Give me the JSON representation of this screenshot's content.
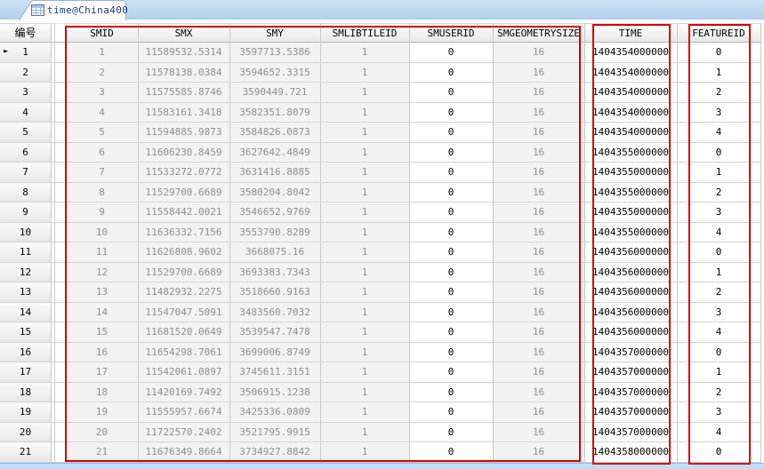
{
  "tab": {
    "label": "time@China400",
    "icon": "table-icon"
  },
  "table": {
    "corner_label": "编号",
    "selected_row": "1",
    "columns": [
      {
        "key": "smid",
        "label": "SMID",
        "readonly": true
      },
      {
        "key": "smx",
        "label": "SMX",
        "readonly": true
      },
      {
        "key": "smy",
        "label": "SMY",
        "readonly": true
      },
      {
        "key": "smlibtileid",
        "label": "SMLIBTILEID",
        "readonly": true
      },
      {
        "key": "smuserid",
        "label": "SMUSERID",
        "readonly": false
      },
      {
        "key": "smgeometrysize",
        "label": "SMGEOMETRYSIZE",
        "readonly": true
      },
      {
        "key": "time",
        "label": "TIME",
        "readonly": false
      },
      {
        "key": "featureid",
        "label": "FEATUREID",
        "readonly": false
      }
    ],
    "rows": [
      {
        "num": "1",
        "smid": "1",
        "smx": "11589532.5314",
        "smy": "3597713.5386",
        "smlibtileid": "1",
        "smuserid": "0",
        "smgeometrysize": "16",
        "time": "1404354000000",
        "featureid": "0"
      },
      {
        "num": "2",
        "smid": "2",
        "smx": "11578138.0384",
        "smy": "3594652.3315",
        "smlibtileid": "1",
        "smuserid": "0",
        "smgeometrysize": "16",
        "time": "1404354000000",
        "featureid": "1"
      },
      {
        "num": "3",
        "smid": "3",
        "smx": "11575585.8746",
        "smy": "3590449.721",
        "smlibtileid": "1",
        "smuserid": "0",
        "smgeometrysize": "16",
        "time": "1404354000000",
        "featureid": "2"
      },
      {
        "num": "4",
        "smid": "4",
        "smx": "11583161.3418",
        "smy": "3582351.8079",
        "smlibtileid": "1",
        "smuserid": "0",
        "smgeometrysize": "16",
        "time": "1404354000000",
        "featureid": "3"
      },
      {
        "num": "5",
        "smid": "5",
        "smx": "11594885.9873",
        "smy": "3584826.0873",
        "smlibtileid": "1",
        "smuserid": "0",
        "smgeometrysize": "16",
        "time": "1404354000000",
        "featureid": "4"
      },
      {
        "num": "6",
        "smid": "6",
        "smx": "11606230.8459",
        "smy": "3627642.4849",
        "smlibtileid": "1",
        "smuserid": "0",
        "smgeometrysize": "16",
        "time": "1404355000000",
        "featureid": "0"
      },
      {
        "num": "7",
        "smid": "7",
        "smx": "11533272.0772",
        "smy": "3631416.8885",
        "smlibtileid": "1",
        "smuserid": "0",
        "smgeometrysize": "16",
        "time": "1404355000000",
        "featureid": "1"
      },
      {
        "num": "8",
        "smid": "8",
        "smx": "11529700.6689",
        "smy": "3580204.8042",
        "smlibtileid": "1",
        "smuserid": "0",
        "smgeometrysize": "16",
        "time": "1404355000000",
        "featureid": "2"
      },
      {
        "num": "9",
        "smid": "9",
        "smx": "11558442.0021",
        "smy": "3546652.9769",
        "smlibtileid": "1",
        "smuserid": "0",
        "smgeometrysize": "16",
        "time": "1404355000000",
        "featureid": "3"
      },
      {
        "num": "10",
        "smid": "10",
        "smx": "11636332.7156",
        "smy": "3553790.8289",
        "smlibtileid": "1",
        "smuserid": "0",
        "smgeometrysize": "16",
        "time": "1404355000000",
        "featureid": "4"
      },
      {
        "num": "11",
        "smid": "11",
        "smx": "11626808.9602",
        "smy": "3668075.16",
        "smlibtileid": "1",
        "smuserid": "0",
        "smgeometrysize": "16",
        "time": "1404356000000",
        "featureid": "0"
      },
      {
        "num": "12",
        "smid": "12",
        "smx": "11529700.6689",
        "smy": "3693383.7343",
        "smlibtileid": "1",
        "smuserid": "0",
        "smgeometrysize": "16",
        "time": "1404356000000",
        "featureid": "1"
      },
      {
        "num": "13",
        "smid": "13",
        "smx": "11482932.2275",
        "smy": "3518660.9163",
        "smlibtileid": "1",
        "smuserid": "0",
        "smgeometrysize": "16",
        "time": "1404356000000",
        "featureid": "2"
      },
      {
        "num": "14",
        "smid": "14",
        "smx": "11547047.5091",
        "smy": "3483560.7032",
        "smlibtileid": "1",
        "smuserid": "0",
        "smgeometrysize": "16",
        "time": "1404356000000",
        "featureid": "3"
      },
      {
        "num": "15",
        "smid": "15",
        "smx": "11681520.0649",
        "smy": "3539547.7478",
        "smlibtileid": "1",
        "smuserid": "0",
        "smgeometrysize": "16",
        "time": "1404356000000",
        "featureid": "4"
      },
      {
        "num": "16",
        "smid": "16",
        "smx": "11654298.7061",
        "smy": "3699006.8749",
        "smlibtileid": "1",
        "smuserid": "0",
        "smgeometrysize": "16",
        "time": "1404357000000",
        "featureid": "0"
      },
      {
        "num": "17",
        "smid": "17",
        "smx": "11542061.0897",
        "smy": "3745611.3151",
        "smlibtileid": "1",
        "smuserid": "0",
        "smgeometrysize": "16",
        "time": "1404357000000",
        "featureid": "1"
      },
      {
        "num": "18",
        "smid": "18",
        "smx": "11420169.7492",
        "smy": "3506915.1238",
        "smlibtileid": "1",
        "smuserid": "0",
        "smgeometrysize": "16",
        "time": "1404357000000",
        "featureid": "2"
      },
      {
        "num": "19",
        "smid": "19",
        "smx": "11555957.6674",
        "smy": "3425336.0809",
        "smlibtileid": "1",
        "smuserid": "0",
        "smgeometrysize": "16",
        "time": "1404357000000",
        "featureid": "3"
      },
      {
        "num": "20",
        "smid": "20",
        "smx": "11722570.2402",
        "smy": "3521795.9915",
        "smlibtileid": "1",
        "smuserid": "0",
        "smgeometrysize": "16",
        "time": "1404357000000",
        "featureid": "4"
      },
      {
        "num": "21",
        "smid": "21",
        "smx": "11676349.8664",
        "smy": "3734927.8842",
        "smlibtileid": "1",
        "smuserid": "0",
        "smgeometrysize": "16",
        "time": "1404358000000",
        "featureid": "0"
      }
    ]
  },
  "annotations": {
    "color": "#d40000",
    "boxes": [
      {
        "name": "sm-fields-box",
        "around": "SMID through SMGEOMETRYSIZE columns"
      },
      {
        "name": "time-box",
        "around": "TIME column"
      },
      {
        "name": "featureid-box",
        "around": "FEATUREID column"
      }
    ]
  },
  "colors": {
    "readonly_cell_bg": "#f2f2f2",
    "readonly_cell_text": "#8e8e8e",
    "editable_cell_bg": "#ffffff",
    "editable_cell_text": "#000000",
    "grid_line": "#c9c9c9",
    "tab_text": "#1e3c78",
    "tabbar_bg": "#b3cfeb",
    "bottom_strip": "#c3ddf4",
    "annotation_red": "#d40000"
  }
}
